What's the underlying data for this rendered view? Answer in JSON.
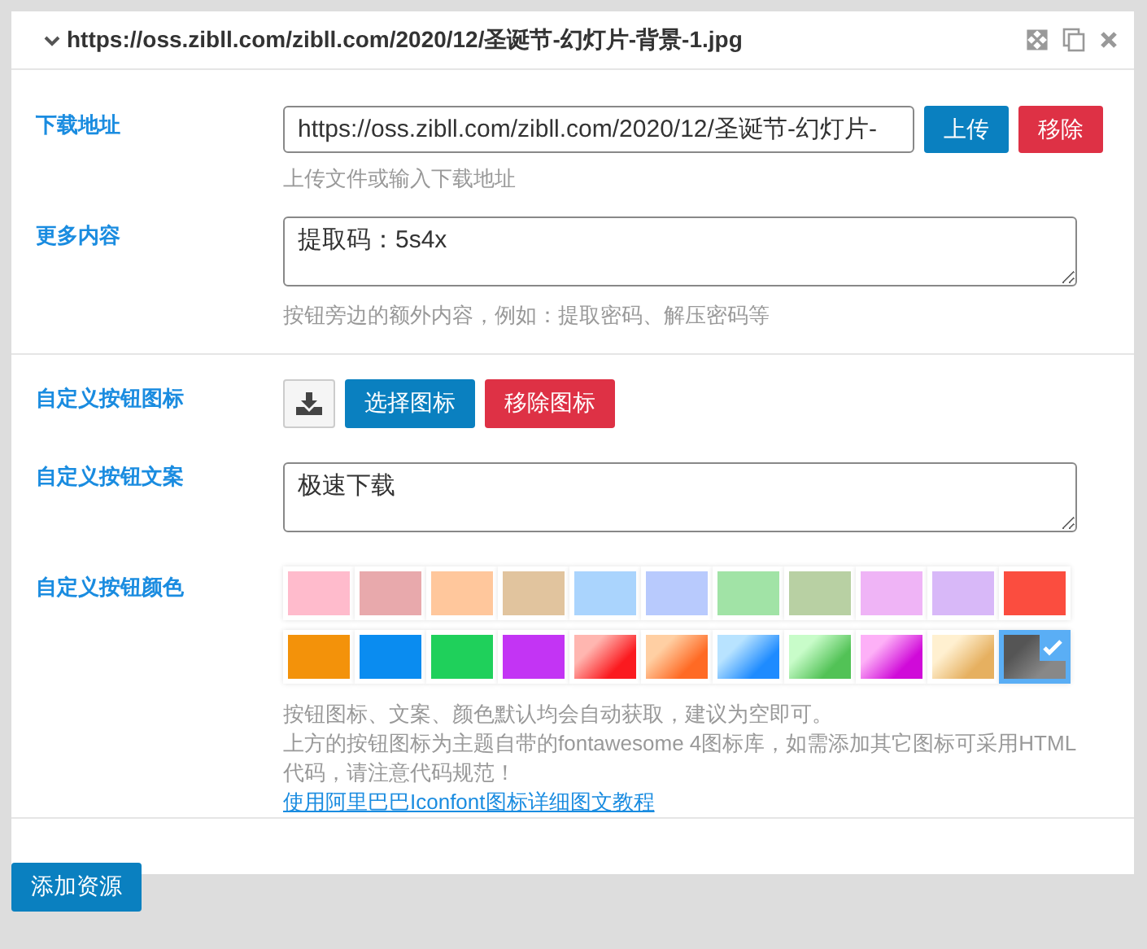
{
  "panel": {
    "title": "https://oss.zibll.com/zibll.com/2020/12/圣诞节-幻灯片-背景-1.jpg",
    "expanded": true
  },
  "download": {
    "label": "下载地址",
    "value": "https://oss.zibll.com/zibll.com/2020/12/圣诞节-幻灯片-",
    "upload_button": "上传",
    "remove_button": "移除",
    "hint": "上传文件或输入下载地址"
  },
  "more": {
    "label": "更多内容",
    "value": "提取码：5s4x",
    "hint": "按钮旁边的额外内容，例如：提取密码、解压密码等"
  },
  "icon": {
    "label": "自定义按钮图标",
    "choose_button": "选择图标",
    "remove_button": "移除图标"
  },
  "text": {
    "label": "自定义按钮文案",
    "value": "极速下载"
  },
  "color": {
    "label": "自定义按钮颜色",
    "swatches": [
      {
        "kind": "solid",
        "color": "#ffbbcc",
        "selected": false
      },
      {
        "kind": "solid",
        "color": "#e8a9ac",
        "selected": false
      },
      {
        "kind": "solid",
        "color": "#ffc79c",
        "selected": false
      },
      {
        "kind": "solid",
        "color": "#e1c49e",
        "selected": false
      },
      {
        "kind": "solid",
        "color": "#aad4fd",
        "selected": false
      },
      {
        "kind": "solid",
        "color": "#b8cafd",
        "selected": false
      },
      {
        "kind": "solid",
        "color": "#a1e3a6",
        "selected": false
      },
      {
        "kind": "solid",
        "color": "#b8d0a3",
        "selected": false
      },
      {
        "kind": "solid",
        "color": "#efb4f6",
        "selected": false
      },
      {
        "kind": "solid",
        "color": "#d8b8f8",
        "selected": false
      },
      {
        "kind": "solid",
        "color": "#fb4d3f",
        "selected": false
      },
      {
        "kind": "solid",
        "color": "#f3920a",
        "selected": false
      },
      {
        "kind": "solid",
        "color": "#0a8cf0",
        "selected": false
      },
      {
        "kind": "solid",
        "color": "#1fd05b",
        "selected": false
      },
      {
        "kind": "solid",
        "color": "#c334f4",
        "selected": false
      },
      {
        "kind": "gradient",
        "stops": [
          {
            "color": "#ffb6b0"
          },
          {
            "color": "#fb1a1f"
          }
        ],
        "selected": false
      },
      {
        "kind": "gradient",
        "stops": [
          {
            "color": "#ffcfa3"
          },
          {
            "color": "#ff6a24"
          }
        ],
        "selected": false
      },
      {
        "kind": "gradient",
        "stops": [
          {
            "color": "#b8e3ff"
          },
          {
            "color": "#1e8bff"
          }
        ],
        "selected": false
      },
      {
        "kind": "gradient",
        "stops": [
          {
            "color": "#c8fcc9"
          },
          {
            "color": "#52c256"
          }
        ],
        "selected": false
      },
      {
        "kind": "gradient",
        "stops": [
          {
            "color": "#fdb0f7"
          },
          {
            "color": "#d00ad9"
          }
        ],
        "selected": false
      },
      {
        "kind": "gradient",
        "stops": [
          {
            "color": "#fff0d0"
          },
          {
            "color": "#e6b060"
          }
        ],
        "selected": false
      },
      {
        "kind": "gradient",
        "stops": [
          {
            "color": "#555555"
          },
          {
            "color": "#888888"
          }
        ],
        "selected": true
      }
    ],
    "hints": [
      "按钮图标、文案、颜色默认均会自动获取，建议为空即可。",
      "上方的按钮图标为主题自带的fontawesome 4图标库，如需添加其它图标可采用HTML代码，请注意代码规范！"
    ],
    "link": "使用阿里巴巴Iconfont图标详细图文教程"
  },
  "add_button": "添加资源"
}
